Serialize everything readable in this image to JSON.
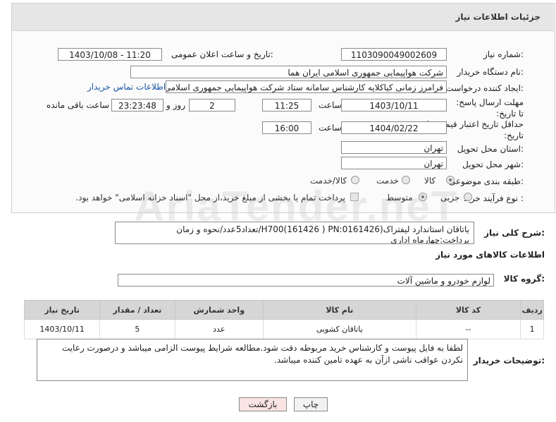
{
  "header": {
    "title": "جزئیات اطلاعات نیاز"
  },
  "fields": {
    "need_number": {
      "label": "شماره نیاز:",
      "value": "1103090049002609"
    },
    "announce_datetime": {
      "label": "تاریخ و ساعت اعلان عمومی:",
      "value": "1403/10/08 - 11:20"
    },
    "buyer_org": {
      "label": "نام دستگاه خریدار:",
      "value": "شرکت هواپیمایی جمهوری اسلامی ایران هما"
    },
    "requester": {
      "label": "ایجاد کننده درخواست:",
      "value": "فرامرز زمانی کیاکلایه کارشناس سامانه ستاد شرکت هواپیمایی جمهوری اسلامی",
      "contact_link": "اطلاعات تماس خریدار"
    },
    "deadline": {
      "label": "مهلت ارسال پاسخ: تا تاریخ:",
      "date": "1403/10/11",
      "time_label": "ساعت",
      "time": "11:25",
      "days": "2",
      "days_label": "روز و",
      "remaining": "23:23:48",
      "remaining_label": "ساعت باقی مانده"
    },
    "validity": {
      "label": "حداقل تاریخ اعتبار قیمت: تا تاریخ:",
      "date": "1404/02/22",
      "time_label": "ساعت",
      "time": "16:00"
    },
    "province": {
      "label": "استان محل تحویل:",
      "value": "تهران"
    },
    "city": {
      "label": "شهر محل تحویل:",
      "value": "تهران"
    },
    "category": {
      "label": "طبقه بندی موضوعی:",
      "options": [
        "کالا",
        "خدمت",
        "کالا/خدمت"
      ]
    },
    "process": {
      "label": "نوع فرآیند خرید :",
      "options": [
        "جزیی",
        "متوسط"
      ],
      "note": "پرداخت تمام یا بخشی از مبلغ خرید،از محل \"اسناد خزانه اسلامی\" خواهد بود."
    }
  },
  "description": {
    "label": "شرح کلی نیاز:",
    "value": "یاتاقان استاندارد لیفتراک(H700(161426 ) PN:0161426/تعداد5عدد/نحوه و زمان پرداخت:چهارماه اداری"
  },
  "goods_section": {
    "title": "اطلاعات کالاهای مورد نیاز"
  },
  "goods_group": {
    "label": "گروه کالا:",
    "value": "لوازم خودرو و ماشین آلات"
  },
  "table": {
    "headers": [
      "ردیف",
      "کد کالا",
      "نام کالا",
      "واحد شمارش",
      "تعداد / مقدار",
      "تاریخ نیاز"
    ],
    "rows": [
      [
        "1",
        "--",
        "یاتاقان کشویی",
        "عدد",
        "5",
        "1403/10/11"
      ]
    ]
  },
  "buyer_notes": {
    "label": "توضیحات خریدار:",
    "value": "لطفا به فایل پیوست و کارشناس خرید مربوطه دقت شود.مطالعه شرایط پیوست الزامی میباشد و درصورت رعایت نکردن عواقب ناشی ازآن به عهده تامین کننده میباشد."
  },
  "buttons": {
    "print": "چاپ",
    "back": "بازگشت"
  },
  "watermark": "AriaTender.neT",
  "colors": {
    "back_button_bg": "#f9e3e3",
    "link": "#1a55a8",
    "header_bg": "#e6e6e6"
  }
}
